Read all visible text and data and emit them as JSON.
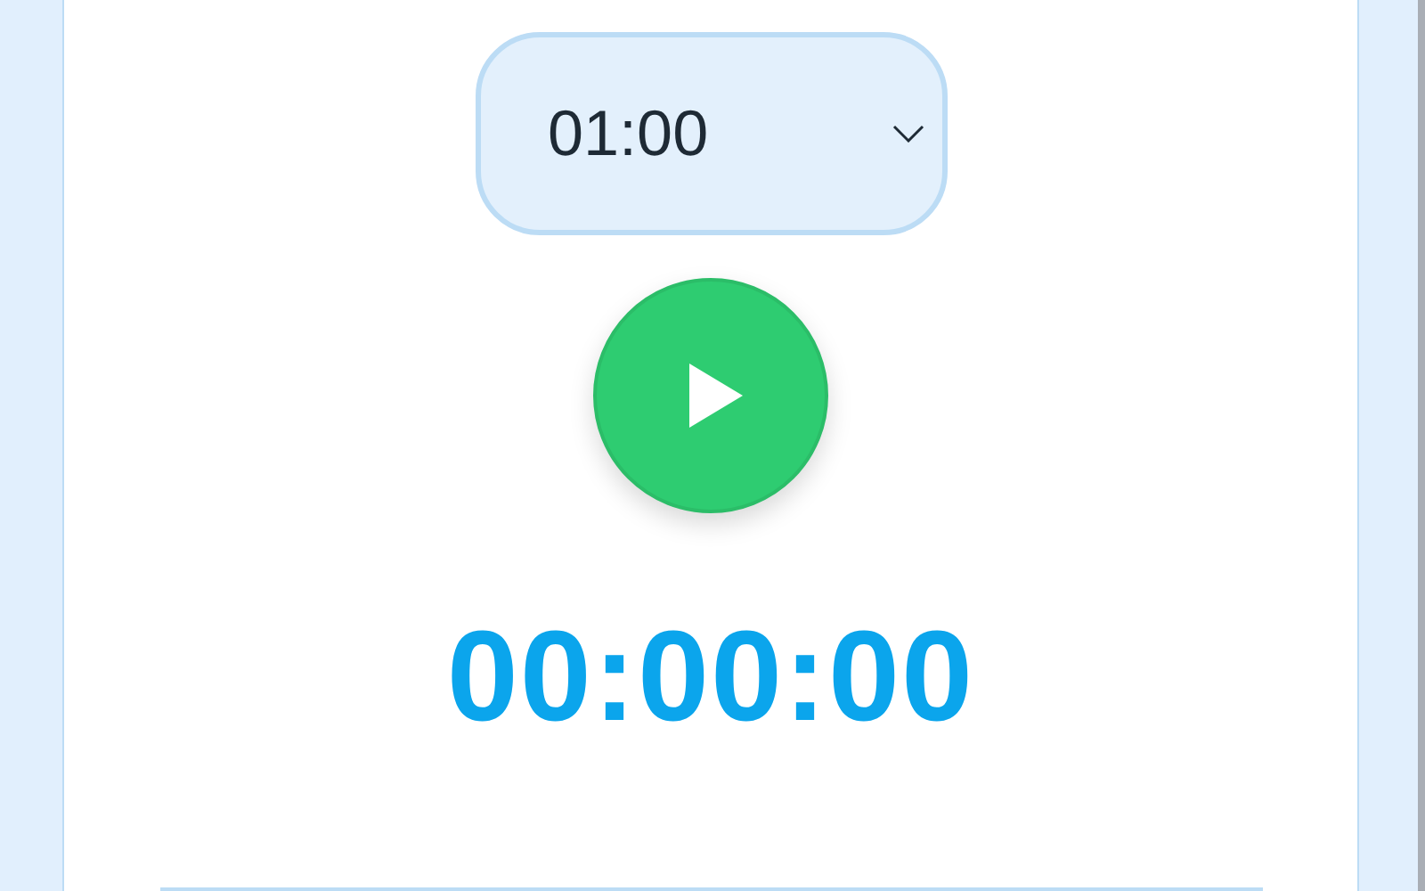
{
  "duration_select": {
    "value": "01:00"
  },
  "timer_display": "00:00:00"
}
